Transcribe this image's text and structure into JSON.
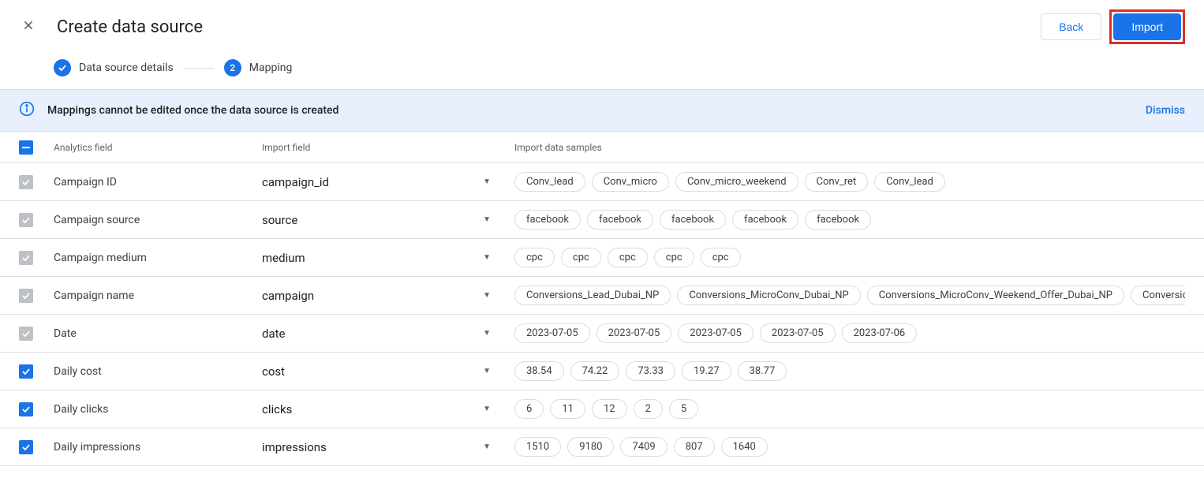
{
  "header": {
    "title": "Create data source",
    "back_label": "Back",
    "import_label": "Import"
  },
  "stepper": {
    "step1_label": "Data source details",
    "step2_num": "2",
    "step2_label": "Mapping"
  },
  "banner": {
    "text": "Mappings cannot be edited once the data source is created",
    "dismiss": "Dismiss"
  },
  "columns": {
    "analytics": "Analytics field",
    "import": "Import field",
    "samples": "Import data samples"
  },
  "rows": [
    {
      "checked": "gray",
      "analytics": "Campaign ID",
      "import": "campaign_id",
      "samples": [
        "Conv_lead",
        "Conv_micro",
        "Conv_micro_weekend",
        "Conv_ret",
        "Conv_lead"
      ]
    },
    {
      "checked": "gray",
      "analytics": "Campaign source",
      "import": "source",
      "samples": [
        "facebook",
        "facebook",
        "facebook",
        "facebook",
        "facebook"
      ]
    },
    {
      "checked": "gray",
      "analytics": "Campaign medium",
      "import": "medium",
      "samples": [
        "cpc",
        "cpc",
        "cpc",
        "cpc",
        "cpc"
      ]
    },
    {
      "checked": "gray",
      "analytics": "Campaign name",
      "import": "campaign",
      "samples": [
        "Conversions_Lead_Dubai_NP",
        "Conversions_MicroConv_Dubai_NP",
        "Conversions_MicroConv_Weekend_Offer_Dubai_NP",
        "Conversions_RET_Le"
      ]
    },
    {
      "checked": "gray",
      "analytics": "Date",
      "import": "date",
      "samples": [
        "2023-07-05",
        "2023-07-05",
        "2023-07-05",
        "2023-07-05",
        "2023-07-06"
      ]
    },
    {
      "checked": "blue",
      "analytics": "Daily cost",
      "import": "cost",
      "samples": [
        "38.54",
        "74.22",
        "73.33",
        "19.27",
        "38.77"
      ]
    },
    {
      "checked": "blue",
      "analytics": "Daily clicks",
      "import": "clicks",
      "samples": [
        "6",
        "11",
        "12",
        "2",
        "5"
      ]
    },
    {
      "checked": "blue",
      "analytics": "Daily impressions",
      "import": "impressions",
      "samples": [
        "1510",
        "9180",
        "7409",
        "807",
        "1640"
      ]
    }
  ]
}
